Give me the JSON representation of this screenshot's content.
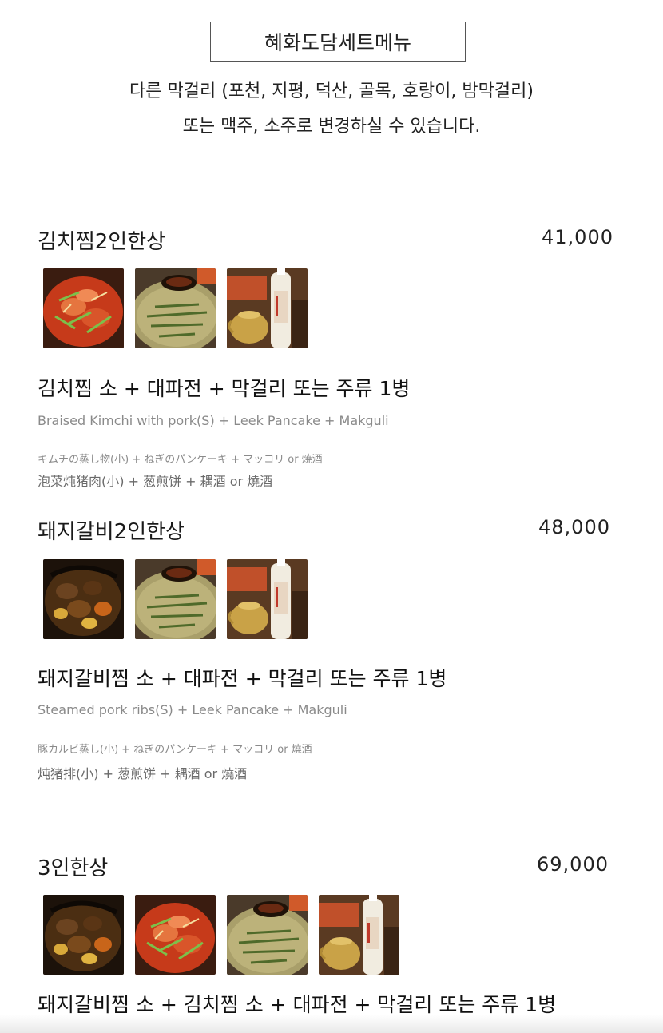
{
  "header": {
    "title": "혜화도담세트메뉴",
    "notice_line1": "다른 막걸리 (포천, 지평, 덕산, 골목, 호랑이, 밤막걸리)",
    "notice_line2": "또는 맥주, 소주로 변경하실 수 있습니다."
  },
  "sets": [
    {
      "name": "김치찜2인한상",
      "price": "41,000",
      "photos": [
        "kimchi-jjim-photo",
        "pajeon-photo",
        "makgeolli-photo"
      ],
      "desc_ko": "김치찜 소 + 대파전 + 막걸리 또는 주류 1병",
      "desc_en": "Braised Kimchi with pork(S) + Leek Pancake + Makguli",
      "desc_ja": "キムチの蒸し物(小) + ねぎのパンケーキ + マッコリ or 焼酒",
      "desc_zh": "泡菜炖猪肉(小) + 葱煎饼 + 耦酒 or 燒酒"
    },
    {
      "name": "돼지갈비2인한상",
      "price": "48,000",
      "photos": [
        "galbi-jjim-photo",
        "pajeon-photo",
        "makgeolli-photo"
      ],
      "desc_ko": "돼지갈비찜 소 + 대파전 + 막걸리 또는 주류 1병",
      "desc_en": "Steamed pork ribs(S) + Leek Pancake + Makguli",
      "desc_ja": "豚カルビ蒸し(小) + ねぎのパンケーキ + マッコリ or 燒酒",
      "desc_zh": "炖猪排(小) + 葱煎饼 + 耦酒 or 燒酒"
    },
    {
      "name": "3인한상",
      "price": "69,000",
      "photos": [
        "galbi-jjim-photo",
        "kimchi-jjim-photo",
        "pajeon-photo",
        "makgeolli-photo"
      ],
      "desc_ko": "돼지갈비찜 소 + 김치찜 소 + 대파전 + 막걸리 또는 주류 1병"
    }
  ]
}
